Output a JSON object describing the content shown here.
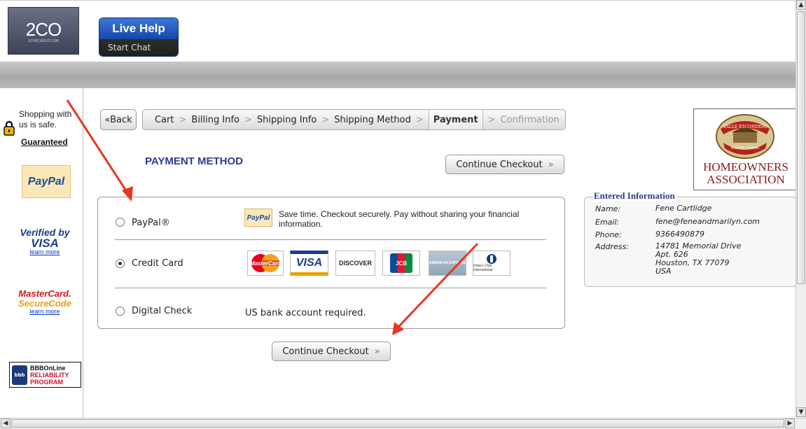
{
  "header": {
    "logo_text": "2CO",
    "logo_subtext": "2CHECKOUT.COM",
    "live_help": {
      "title": "Live Help",
      "subtitle": "Start Chat"
    }
  },
  "sidebar": {
    "safe_text": "Shopping with us is safe.",
    "guaranteed": "Guaranteed",
    "paypal": "PayPal",
    "verified_by_visa": {
      "line1": "Verified by",
      "line2": "VISA",
      "link": "learn more"
    },
    "mastercard_securecode": {
      "line1": "MasterCard.",
      "line2": "SecureCode",
      "link": "learn more"
    },
    "bbb": {
      "seal": "bbb",
      "line1": "BBBOnLine",
      "line2": "RELIABILITY",
      "line3": "PROGRAM"
    }
  },
  "breadcrumb": {
    "back": "«Back",
    "steps": [
      "Cart",
      "Billing Info",
      "Shipping Info",
      "Shipping Method",
      "Payment",
      "Confirmation"
    ],
    "active": "Payment",
    "separator": ">"
  },
  "payment": {
    "title": "PAYMENT METHOD",
    "continue_label": "Continue Checkout",
    "continue_chevron": "»",
    "options": [
      {
        "label": "PayPal®",
        "selected": false,
        "logo": "PayPal",
        "note": "Save time. Checkout securely. Pay without sharing your financial information."
      },
      {
        "label": "Credit Card",
        "selected": true,
        "cards": [
          "MasterCard",
          "VISA",
          "DISCOVER",
          "JCB",
          "AMERICAN EXPRESS",
          "Diners Club International"
        ]
      },
      {
        "label": "Digital Check",
        "selected": false,
        "note": "US bank account required."
      }
    ]
  },
  "hoa": {
    "seal_top": "VALLE ESCONDIDO",
    "seal_bottom": "BOQUETE · PANAMA",
    "line1": "HOMEOWNERS",
    "line2": "ASSOCIATION"
  },
  "entered_info": {
    "title": "Entered Information",
    "name_label": "Name:",
    "name": "Fene Cartlidge",
    "email_label": "Email:",
    "email": "fene@feneandmarilyn.com",
    "phone_label": "Phone:",
    "phone": "9366490879",
    "address_label": "Address:",
    "address": [
      "14781 Memorial Drive",
      "Apt. 626",
      "Houston, TX 77079",
      "USA"
    ]
  },
  "colors": {
    "accent": "#2f3a8f",
    "annotation_arrow": "#e8361f",
    "hoa_text": "#8b1a1a"
  }
}
